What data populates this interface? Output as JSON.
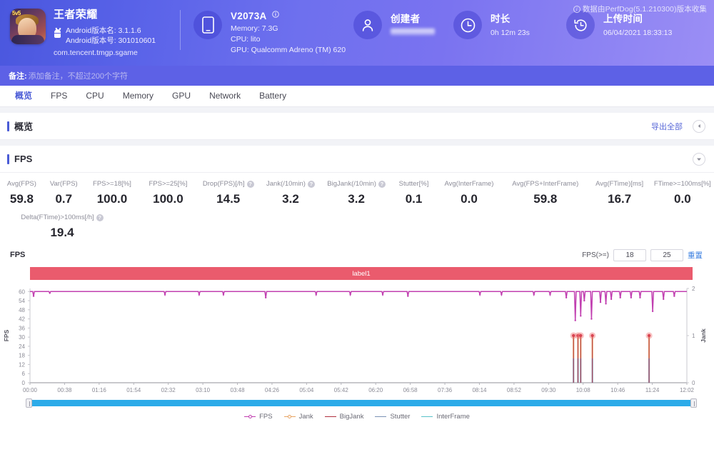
{
  "header": {
    "perfdog_note": "数据由PerfDog(5.1.210300)版本收集",
    "app": {
      "name": "王者荣耀",
      "version_name": "Android版本名: 3.1.1.6",
      "version_code": "Android版本号: 301010601",
      "package": "com.tencent.tmgp.sgame"
    },
    "device": {
      "title": "V2073A",
      "memory": "Memory: 7.3G",
      "cpu": "CPU: lito",
      "gpu": "GPU: Qualcomm Adreno (TM) 620"
    },
    "creator": {
      "title": "创建者",
      "value": ""
    },
    "duration": {
      "title": "时长",
      "value": "0h 12m 23s"
    },
    "upload": {
      "title": "上传时间",
      "value": "06/04/2021 18:33:13"
    },
    "remark_label": "备注:",
    "remark_placeholder": "添加备注，不超过200个字符"
  },
  "tabs": [
    {
      "label": "概览",
      "active": true
    },
    {
      "label": "FPS",
      "active": false
    },
    {
      "label": "CPU",
      "active": false
    },
    {
      "label": "Memory",
      "active": false
    },
    {
      "label": "GPU",
      "active": false
    },
    {
      "label": "Network",
      "active": false
    },
    {
      "label": "Battery",
      "active": false
    }
  ],
  "overview": {
    "title": "概览",
    "export_label": "导出全部"
  },
  "fps_section": {
    "title": "FPS",
    "metrics_row1": [
      {
        "label": "Avg(FPS)",
        "value": "59.8",
        "help": false
      },
      {
        "label": "Var(FPS)",
        "value": "0.7",
        "help": false
      },
      {
        "label": "FPS>=18[%]",
        "value": "100.0",
        "help": false
      },
      {
        "label": "FPS>=25[%]",
        "value": "100.0",
        "help": false
      },
      {
        "label": "Drop(FPS)[/h]",
        "value": "14.5",
        "help": true
      },
      {
        "label": "Jank(/10min)",
        "value": "3.2",
        "help": true
      },
      {
        "label": "BigJank(/10min)",
        "value": "3.2",
        "help": true
      },
      {
        "label": "Stutter[%]",
        "value": "0.1",
        "help": false
      },
      {
        "label": "Avg(InterFrame)",
        "value": "0.0",
        "help": false
      },
      {
        "label": "Avg(FPS+InterFrame)",
        "value": "59.8",
        "help": false
      },
      {
        "label": "Avg(FTime)[ms]",
        "value": "16.7",
        "help": false
      },
      {
        "label": "FTime>=100ms[%]",
        "value": "0.0",
        "help": false
      }
    ],
    "metrics_row2": [
      {
        "label": "Delta(FTime)>100ms[/h]",
        "value": "19.4",
        "help": true
      }
    ],
    "chart_label": "FPS",
    "threshold_label": "FPS(>=)",
    "threshold_low": "18",
    "threshold_high": "25",
    "reset_label": "重置",
    "tag_bar_label": "label1"
  },
  "chart_data": {
    "type": "line",
    "title": "FPS",
    "xlabel": "",
    "ylabel": "FPS",
    "y2label": "Jank",
    "grid": false,
    "legend_position": "bottom",
    "xlim": [
      0,
      730
    ],
    "ylim": [
      0,
      62
    ],
    "y2lim": [
      0,
      2
    ],
    "yticks": [
      0,
      6,
      12,
      18,
      24,
      30,
      36,
      42,
      48,
      54,
      60
    ],
    "y2ticks": [
      0,
      1,
      2
    ],
    "xticks": [
      "00:00",
      "00:38",
      "01:16",
      "01:54",
      "02:32",
      "03:10",
      "03:48",
      "04:26",
      "05:04",
      "05:42",
      "06:20",
      "06:58",
      "07:36",
      "08:14",
      "08:52",
      "09:30",
      "10:08",
      "10:46",
      "11:24",
      "12:02"
    ],
    "legend": [
      {
        "name": "FPS",
        "color": "#c13fb0",
        "marker": "circle"
      },
      {
        "name": "Jank",
        "color": "#e8a463",
        "marker": "circle"
      },
      {
        "name": "BigJank",
        "color": "#b0303f",
        "marker": "line"
      },
      {
        "name": "Stutter",
        "color": "#7b92b5",
        "marker": "line"
      },
      {
        "name": "InterFrame",
        "color": "#59c2c9",
        "marker": "line"
      }
    ],
    "series": [
      {
        "name": "FPS",
        "color": "#c13fb0",
        "axis": "left",
        "baseline": 60,
        "dips": [
          {
            "t": 4,
            "v": 57
          },
          {
            "t": 22,
            "v": 59
          },
          {
            "t": 150,
            "v": 58
          },
          {
            "t": 188,
            "v": 58
          },
          {
            "t": 215,
            "v": 58
          },
          {
            "t": 262,
            "v": 56
          },
          {
            "t": 318,
            "v": 58
          },
          {
            "t": 356,
            "v": 58
          },
          {
            "t": 392,
            "v": 58
          },
          {
            "t": 420,
            "v": 57
          },
          {
            "t": 500,
            "v": 58
          },
          {
            "t": 524,
            "v": 58
          },
          {
            "t": 560,
            "v": 58
          },
          {
            "t": 578,
            "v": 58
          },
          {
            "t": 596,
            "v": 56
          },
          {
            "t": 606,
            "v": 41
          },
          {
            "t": 612,
            "v": 44
          },
          {
            "t": 616,
            "v": 54
          },
          {
            "t": 624,
            "v": 42
          },
          {
            "t": 634,
            "v": 53
          },
          {
            "t": 640,
            "v": 52
          },
          {
            "t": 646,
            "v": 55
          },
          {
            "t": 656,
            "v": 56
          },
          {
            "t": 668,
            "v": 56
          },
          {
            "t": 678,
            "v": 56
          },
          {
            "t": 692,
            "v": 47
          },
          {
            "t": 704,
            "v": 55
          },
          {
            "t": 716,
            "v": 57
          }
        ]
      },
      {
        "name": "Jank",
        "color": "#e8a463",
        "axis": "right",
        "spikes": [
          {
            "t": 604,
            "v": 1
          },
          {
            "t": 609,
            "v": 1
          },
          {
            "t": 612,
            "v": 1
          },
          {
            "t": 625,
            "v": 1
          },
          {
            "t": 688,
            "v": 1
          }
        ]
      },
      {
        "name": "BigJank",
        "color": "#b0303f",
        "axis": "right",
        "spikes": [
          {
            "t": 604,
            "v": 1
          },
          {
            "t": 609,
            "v": 1
          },
          {
            "t": 612,
            "v": 1
          },
          {
            "t": 625,
            "v": 1
          },
          {
            "t": 688,
            "v": 1
          }
        ]
      },
      {
        "name": "Stutter",
        "color": "#7b92b5",
        "axis": "right",
        "spikes": [
          {
            "t": 604,
            "v": 0.52
          },
          {
            "t": 609,
            "v": 0.52
          },
          {
            "t": 612,
            "v": 0.52
          },
          {
            "t": 625,
            "v": 0.52
          },
          {
            "t": 688,
            "v": 0.52
          }
        ]
      },
      {
        "name": "InterFrame",
        "color": "#59c2c9",
        "axis": "left",
        "values": []
      }
    ]
  }
}
